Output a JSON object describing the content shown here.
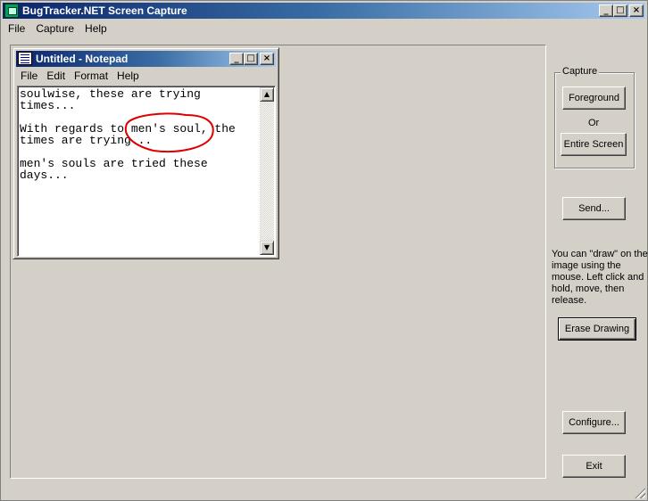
{
  "window": {
    "title": "BugTracker.NET Screen Capture",
    "min": "_",
    "max": "□",
    "close": "×"
  },
  "menu": [
    "File",
    "Capture",
    "Help"
  ],
  "notepad": {
    "title": "Untitled - Notepad",
    "menu": [
      "File",
      "Edit",
      "Format",
      "Help"
    ],
    "lines": [
      "soulwise, these are trying times...",
      "With regards to men's soul, the times are trying...",
      "men's souls are tried these days..."
    ],
    "scroll_up": "▲",
    "scroll_down": "▼"
  },
  "capture_group": {
    "label": "Capture",
    "foreground": "Foreground",
    "or": "Or",
    "entire_screen": "Entire Screen"
  },
  "send_label": "Send...",
  "help_text": "You can \"draw\" on the image using the mouse.  Left click and hold, move, then release.",
  "erase_label": "Erase Drawing",
  "configure_label": "Configure...",
  "exit_label": "Exit",
  "colors": {
    "title_active": "#0a246a",
    "face": "#d4d0c8",
    "drawing": "#e00000"
  }
}
